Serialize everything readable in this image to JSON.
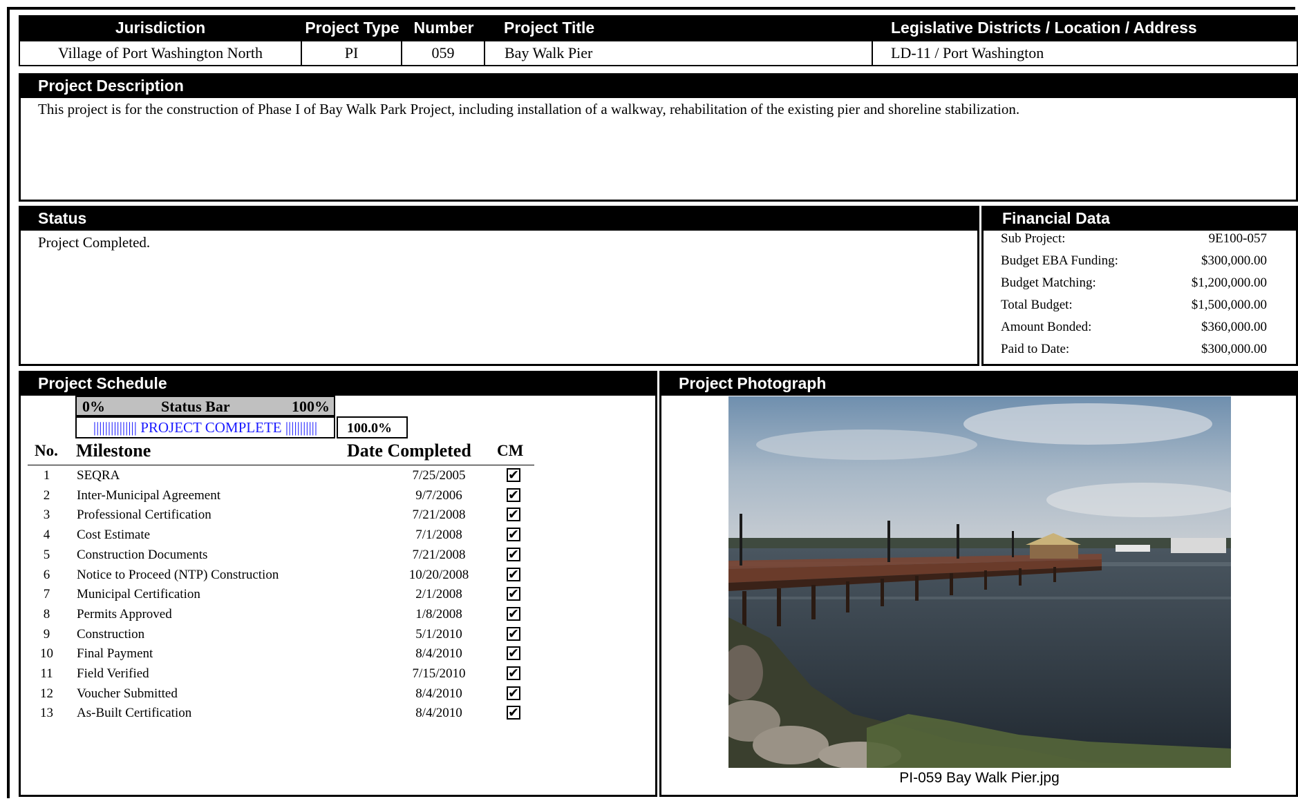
{
  "header": {
    "columns": [
      "Jurisdiction",
      "Project Type",
      "Number",
      "Project Title",
      "Legislative Districts / Location / Address"
    ],
    "values": [
      "Village of Port Washington North",
      "PI",
      "059",
      "Bay Walk Pier",
      "LD-11 / Port Washington"
    ]
  },
  "description": {
    "heading": "Project Description",
    "text": "This project is for the construction of Phase I of Bay Walk Park Project, including installation of a walkway, rehabilitation of the existing pier and shoreline stabilization."
  },
  "status": {
    "heading": "Status",
    "text": "Project Completed."
  },
  "financial": {
    "heading": "Financial Data",
    "rows": [
      {
        "label": "Sub Project:",
        "value": "9E100-057"
      },
      {
        "label": "Budget EBA Funding:",
        "value": "$300,000.00"
      },
      {
        "label": "Budget Matching:",
        "value": "$1,200,000.00"
      },
      {
        "label": "Total Budget:",
        "value": "$1,500,000.00"
      },
      {
        "label": "Amount Bonded:",
        "value": "$360,000.00"
      },
      {
        "label": "Paid to Date:",
        "value": "$300,000.00"
      }
    ]
  },
  "schedule": {
    "heading": "Project Schedule",
    "status_bar": {
      "left": "0%",
      "title": "Status Bar",
      "right": "100%",
      "bar_text": "||||||||||||||| PROJECT COMPLETE |||||||||||",
      "percent": "100.0%",
      "progress": 1.0
    },
    "columns": {
      "no": "No.",
      "milestone": "Milestone",
      "date": "Date Completed",
      "cm": "CM"
    },
    "milestones": [
      {
        "no": "1",
        "name": "SEQRA",
        "date": "7/25/2005",
        "cm": "✔"
      },
      {
        "no": "2",
        "name": "Inter-Municipal Agreement",
        "date": "9/7/2006",
        "cm": "✔"
      },
      {
        "no": "3",
        "name": "Professional Certification",
        "date": "7/21/2008",
        "cm": "✔"
      },
      {
        "no": "4",
        "name": "Cost Estimate",
        "date": "7/1/2008",
        "cm": "✔"
      },
      {
        "no": "5",
        "name": "Construction Documents",
        "date": "7/21/2008",
        "cm": "✔"
      },
      {
        "no": "6",
        "name": "Notice to Proceed (NTP) Construction",
        "date": "10/20/2008",
        "cm": "✔"
      },
      {
        "no": "7",
        "name": "Municipal Certification",
        "date": "2/1/2008",
        "cm": "✔"
      },
      {
        "no": "8",
        "name": "Permits Approved",
        "date": "1/8/2008",
        "cm": "✔"
      },
      {
        "no": "9",
        "name": "Construction",
        "date": "5/1/2010",
        "cm": "✔"
      },
      {
        "no": "10",
        "name": "Final Payment",
        "date": "8/4/2010",
        "cm": "✔"
      },
      {
        "no": "11",
        "name": "Field Verified",
        "date": "7/15/2010",
        "cm": "✔"
      },
      {
        "no": "12",
        "name": "Voucher Submitted",
        "date": "8/4/2010",
        "cm": "✔"
      },
      {
        "no": "13",
        "name": "As-Built Certification",
        "date": "8/4/2010",
        "cm": "✔"
      }
    ]
  },
  "photo": {
    "heading": "Project Photograph",
    "caption": "PI-059 Bay Walk Pier.jpg"
  }
}
